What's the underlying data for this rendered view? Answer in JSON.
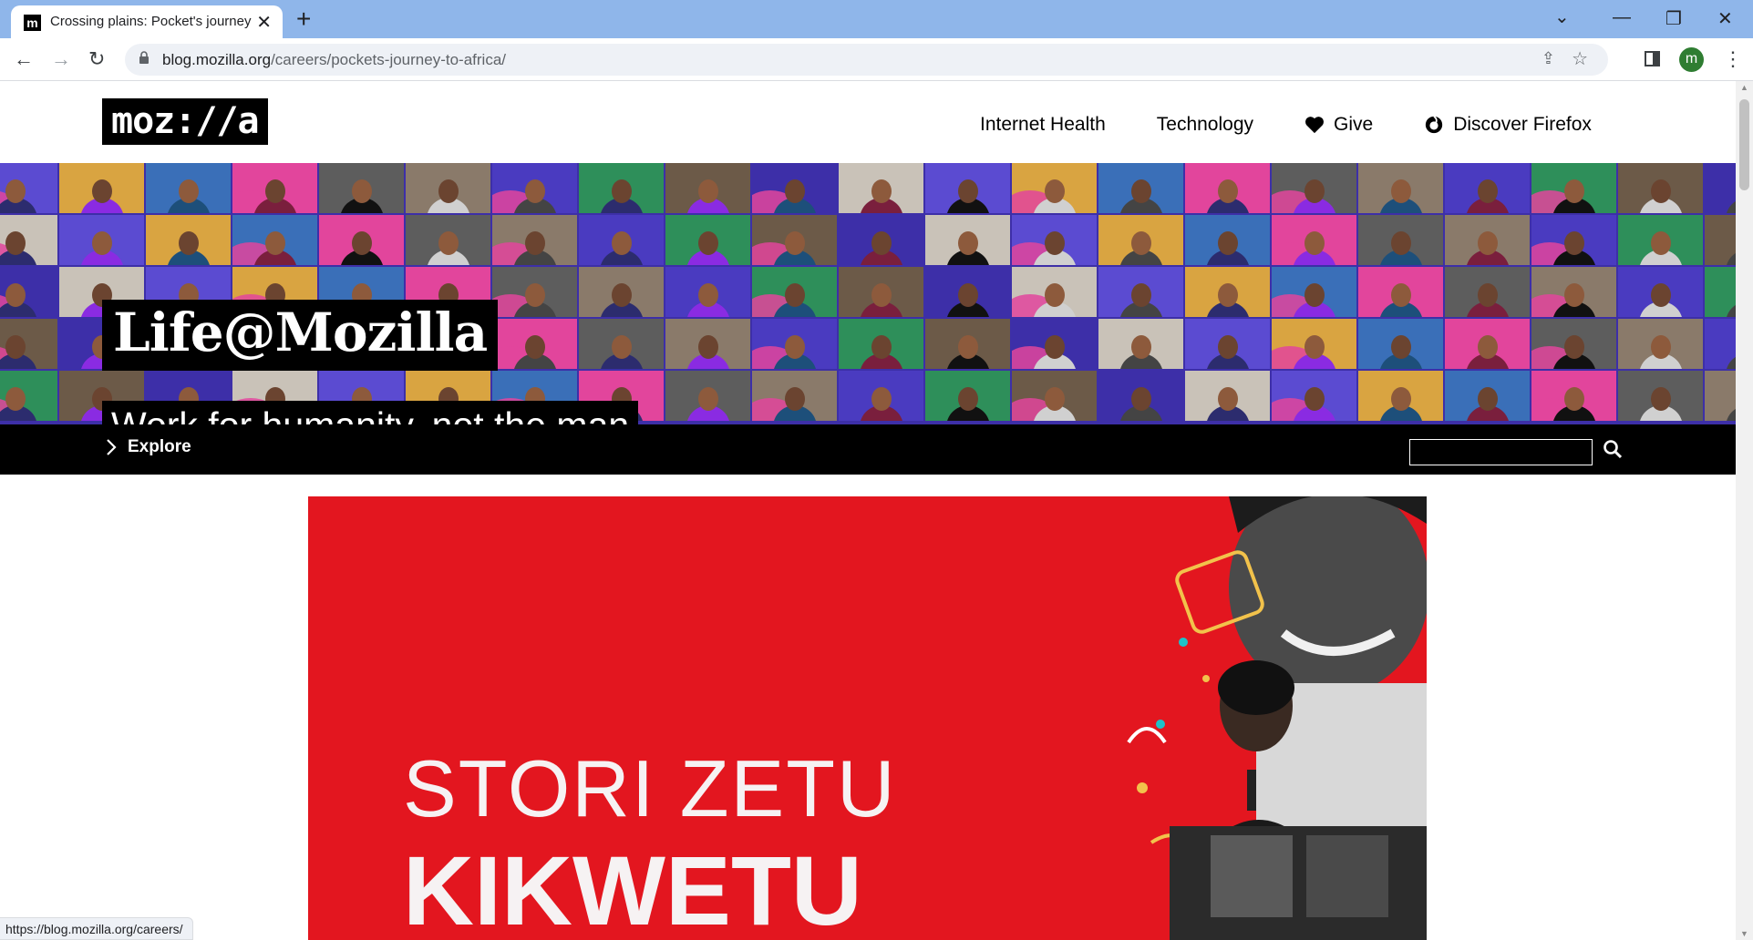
{
  "browser": {
    "tab_title": "Crossing plains: Pocket's journey",
    "favicon_letter": "m",
    "url_domain": "blog.mozilla.org",
    "url_path": "/careers/pockets-journey-to-africa/",
    "profile_initial": "m",
    "status_url": "https://blog.mozilla.org/careers/"
  },
  "site": {
    "logo": "moz://a",
    "nav": [
      {
        "label": "Internet Health"
      },
      {
        "label": "Technology"
      },
      {
        "label": "Give",
        "icon": "heart-icon"
      },
      {
        "label": "Discover Firefox",
        "icon": "firefox-icon"
      }
    ]
  },
  "hero": {
    "title": "Life@Mozilla",
    "subtitle": "Work for humanity, not the man"
  },
  "explore": {
    "label": "Explore",
    "search_value": ""
  },
  "article_image": {
    "line1": "STORI ZETU",
    "line2": "KIKWETU"
  },
  "colors": {
    "chrome_tabbar": "#8fb6ea",
    "hero_bg": "#3d2fa8",
    "accent_pink": "#e2459c",
    "image_red": "#e3161f",
    "profile_green": "#2f7d32"
  }
}
